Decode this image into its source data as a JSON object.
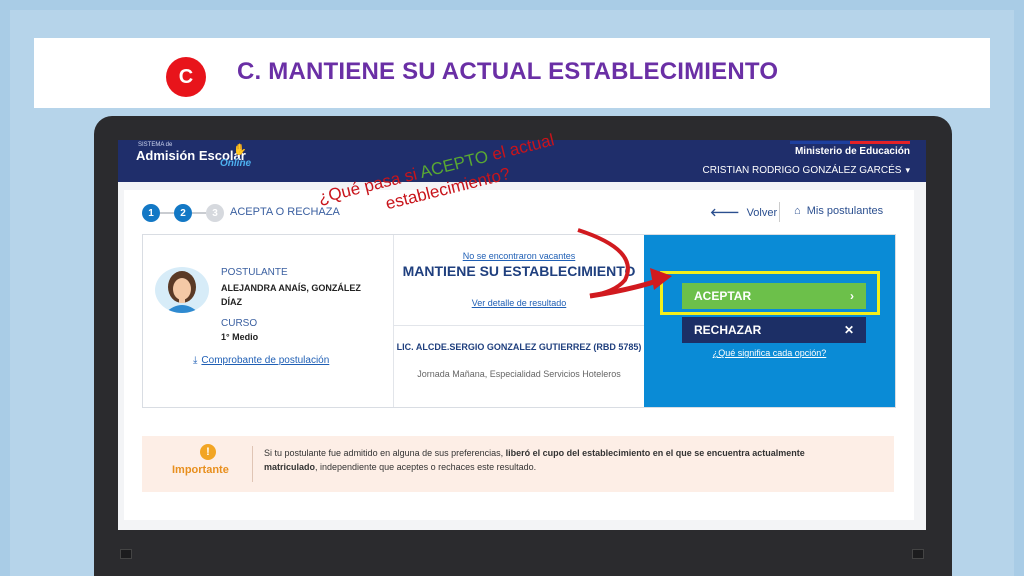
{
  "slide": {
    "badge": "C",
    "title": "C. MANTIENE SU ACTUAL ESTABLECIMIENTO"
  },
  "header": {
    "logo_top": "SISTEMA de",
    "logo_main": "Admisión Escolar",
    "logo_sub": "Online",
    "ministry": "Ministerio de Educación",
    "user_name": "CRISTIAN RODRIGO GONZÁLEZ GARCÉS"
  },
  "steps": {
    "step1": "1",
    "step2": "2",
    "step3": "3",
    "label": "ACEPTA O RECHAZA"
  },
  "nav": {
    "back": "Volver",
    "applicants": "Mis postulantes"
  },
  "applicant": {
    "label": "POSTULANTE",
    "name": "ALEJANDRA ANAÍS, GONZÁLEZ DÍAZ",
    "course_label": "CURSO",
    "course": "1° Medio",
    "receipt_link": "Comprobante de postulación"
  },
  "result": {
    "no_vacancies": "No se encontraron vacantes",
    "status": "MANTIENE SU ESTABLECIMIENTO",
    "detail_link": "Ver detalle de resultado",
    "school_name": "LIC. ALCDE.SERGIO GONZALEZ GUTIERREZ (RBD 5785)",
    "school_desc": "Jornada Mañana, Especialidad Servicios Hoteleros"
  },
  "actions": {
    "accept": "ACEPTAR",
    "reject": "RECHAZAR",
    "options_link": "¿Qué significa cada opción?"
  },
  "important": {
    "icon": "!",
    "label": "Importante",
    "text_1": "Si tu postulante fue admitido en alguna de sus preferencias, ",
    "text_bold": "liberó el cupo del establecimiento en el que se encuentra actualmente matriculado",
    "text_2": ", independiente que aceptes o rechaces este resultado."
  },
  "annotation": {
    "line1_a": "¿Qué pasa si ",
    "line1_green": "ACEPTO",
    "line1_b": " el actual",
    "line2": "establecimiento?"
  },
  "colors": {
    "title": "#6a2fa5",
    "badge": "#e8141b",
    "header": "#1f2e6b",
    "accept": "#6cc04a",
    "reject": "#1c2f66",
    "panel": "#0a8bd6",
    "highlight": "#f3ef1c"
  },
  "icons": {
    "back": "arrow-left-icon",
    "home": "home-icon",
    "download": "download-icon",
    "accept_chevron": "chevron-right-icon",
    "reject_x": "close-icon",
    "user_chevron": "chevron-down-icon"
  }
}
